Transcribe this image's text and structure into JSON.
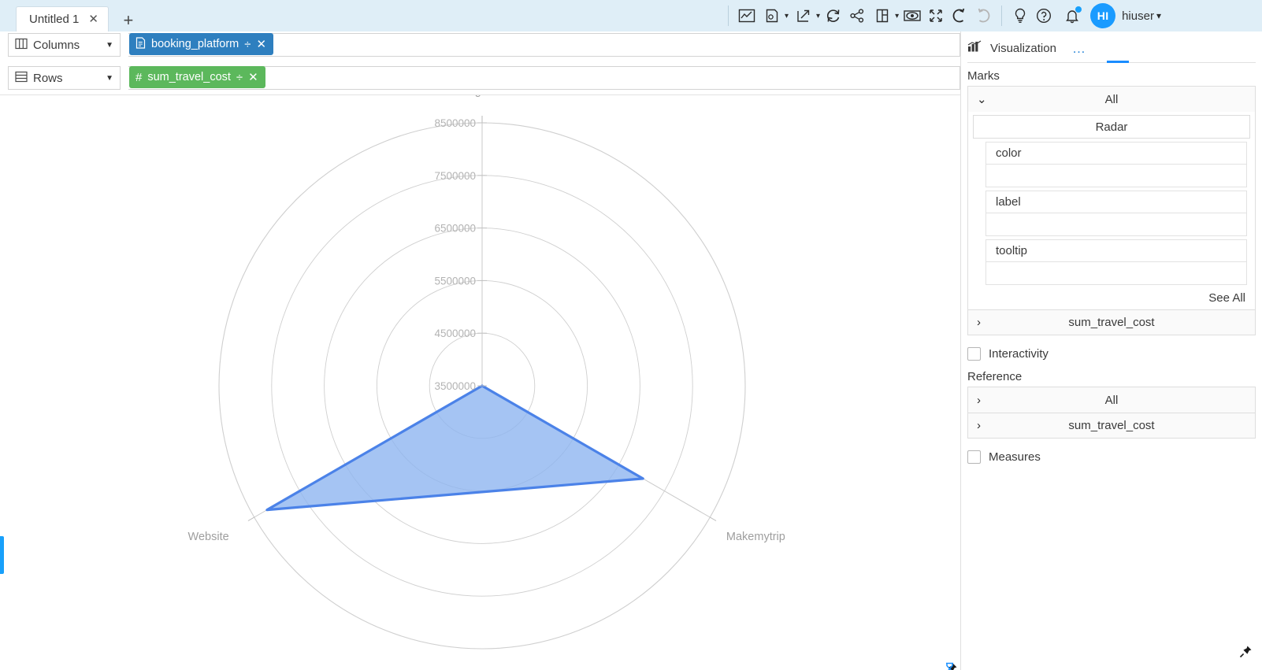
{
  "window": {
    "tab_title": "Untitled 1",
    "tab_close": "✕",
    "new_tab": "+"
  },
  "toolbar": {
    "icons": [
      {
        "name": "chart-line-icon",
        "label": "Chart"
      },
      {
        "name": "save-document-icon",
        "label": "Save"
      },
      {
        "name": "export-icon",
        "label": "Export"
      },
      {
        "name": "refresh-icon",
        "label": "Refresh"
      },
      {
        "name": "share-icon",
        "label": "Share"
      },
      {
        "name": "layout-icon",
        "label": "Layout"
      },
      {
        "name": "preview-eye-icon",
        "label": "Preview"
      },
      {
        "name": "fullscreen-icon",
        "label": "Fullscreen"
      },
      {
        "name": "undo-icon",
        "label": "Undo"
      },
      {
        "name": "redo-icon",
        "label": "Redo"
      }
    ],
    "hint_icon": "lightbulb-icon",
    "help_icon": "help-circle-icon",
    "notification_icon": "bell-icon",
    "avatar_initials": "HI",
    "user_name": "hiuser",
    "user_caret": "˅"
  },
  "shelves": {
    "columns": {
      "label": "Columns",
      "icon": "columns-icon",
      "caret": "▼",
      "pill": {
        "text": "booking_platform",
        "type_icon": "dimension-file-icon",
        "sort_icon": "÷",
        "remove_icon": "✕",
        "color": "#2e7fbf"
      }
    },
    "rows": {
      "label": "Rows",
      "icon": "rows-icon",
      "caret": "▼",
      "pill": {
        "text": "sum_travel_cost",
        "type_icon": "#",
        "sort_icon": "÷",
        "remove_icon": "✕",
        "color": "#5cb85c"
      }
    }
  },
  "chart_data": {
    "type": "radar",
    "title": "",
    "categories": [
      "Agent",
      "Makemytrip",
      "Website"
    ],
    "values": [
      3500000,
      7030000,
      8220000
    ],
    "axis_labels": [
      "Agent",
      "Makemytrip",
      "Website"
    ],
    "tick_labels": [
      "8500000",
      "7500000",
      "6500000",
      "5500000",
      "4500000",
      "3500000"
    ],
    "tick_values": [
      8500000,
      7500000,
      6500000,
      5500000,
      4500000,
      3500000
    ],
    "rlim": [
      3500000,
      8500000
    ],
    "grid": true,
    "legend": "none",
    "series": [
      {
        "name": "sum_travel_cost",
        "values": [
          3500000,
          7030000,
          8220000
        ],
        "fill_color": "#8cb4f0",
        "stroke_color": "#4b82e8"
      }
    ],
    "ylabel": "sum_travel_cost",
    "xlabel": "booking_platform"
  },
  "canvas": {
    "pin_icon": "pin-icon",
    "hourglass_icon": "hourglass-icon"
  },
  "right_panel": {
    "header": {
      "icon": "visualization-icon",
      "title": "Visualization",
      "menu": "…"
    },
    "marks": {
      "section_label": "Marks",
      "group_label": "All",
      "group_chevron": "⌄",
      "mark_type": "Radar",
      "properties": [
        {
          "label": "color",
          "value": ""
        },
        {
          "label": "label",
          "value": ""
        },
        {
          "label": "tooltip",
          "value": ""
        }
      ],
      "see_all": "See All",
      "measure_row": {
        "label": "sum_travel_cost",
        "chevron": "›"
      }
    },
    "interactivity": {
      "label": "Interactivity",
      "checked": false
    },
    "reference": {
      "section_label": "Reference",
      "rows": [
        {
          "label": "All",
          "chevron": "›"
        },
        {
          "label": "sum_travel_cost",
          "chevron": "›"
        }
      ]
    },
    "measures": {
      "label": "Measures",
      "checked": false
    },
    "pin_icon": "pin-icon"
  },
  "colors": {
    "accent": "#18a0fb",
    "tabbar_bg": "#dfeef7",
    "pill_dimension": "#2e7fbf",
    "pill_measure": "#5cb85c",
    "radar_fill": "#8cb4f0",
    "radar_stroke": "#4b82e8"
  }
}
